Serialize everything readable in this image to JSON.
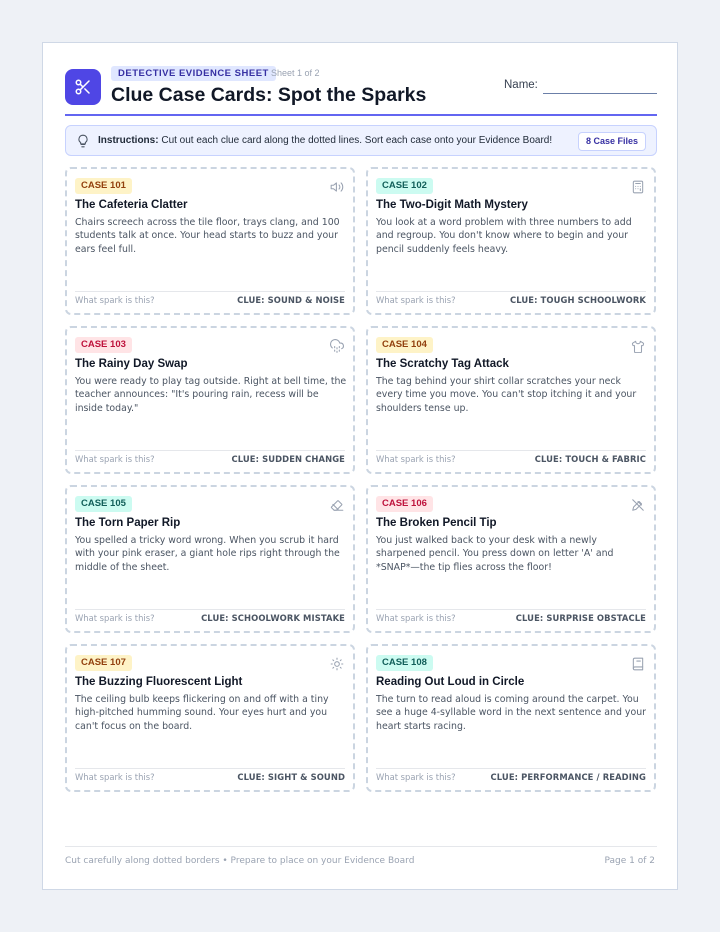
{
  "header": {
    "badge": "DETECTIVE EVIDENCE SHEET",
    "sheet_label": "Sheet 1 of 2",
    "title": "Clue Case Cards: Spot the Sparks",
    "name_label": "Name:"
  },
  "instructions": {
    "label": "Instructions:",
    "text": " Cut out each clue card along the dotted lines. Sort each case onto your Evidence Board!",
    "count": "8 Case Files"
  },
  "cards": [
    {
      "case": "CASE 101",
      "color": "yellow",
      "icon": "speaker-icon",
      "title": "The Cafeteria Clatter",
      "body": "Chairs screech across the tile floor, trays clang, and 100 students talk at once. Your head starts to buzz and your ears feel full.",
      "question": "What spark is this?",
      "clue": "CLUE: SOUND & NOISE"
    },
    {
      "case": "CASE 102",
      "color": "teal",
      "icon": "calculator-icon",
      "title": "The Two-Digit Math Mystery",
      "body": "You look at a word problem with three numbers to add and regroup. You don't know where to begin and your pencil suddenly feels heavy.",
      "question": "What spark is this?",
      "clue": "CLUE: TOUGH SCHOOLWORK"
    },
    {
      "case": "CASE 103",
      "color": "red",
      "icon": "rain-cloud-icon",
      "title": "The Rainy Day Swap",
      "body": "You were ready to play tag outside. Right at bell time, the teacher announces: \"It's pouring rain, recess will be inside today.\"",
      "question": "What spark is this?",
      "clue": "CLUE: SUDDEN CHANGE"
    },
    {
      "case": "CASE 104",
      "color": "yellow",
      "icon": "shirt-icon",
      "title": "The Scratchy Tag Attack",
      "body": "The tag behind your shirt collar scratches your neck every time you move. You can't stop itching it and your shoulders tense up.",
      "question": "What spark is this?",
      "clue": "CLUE: TOUCH & FABRIC"
    },
    {
      "case": "CASE 105",
      "color": "teal",
      "icon": "eraser-icon",
      "title": "The Torn Paper Rip",
      "body": "You spelled a tricky word wrong. When you scrub it hard with your pink eraser, a giant hole rips right through the middle of the sheet.",
      "question": "What spark is this?",
      "clue": "CLUE: SCHOOLWORK MISTAKE"
    },
    {
      "case": "CASE 106",
      "color": "red",
      "icon": "broken-pencil-icon",
      "title": "The Broken Pencil Tip",
      "body": "You just walked back to your desk with a newly sharpened pencil. You press down on letter 'A' and *SNAP*—the tip flies across the floor!",
      "question": "What spark is this?",
      "clue": "CLUE: SURPRISE OBSTACLE"
    },
    {
      "case": "CASE 107",
      "color": "yellow",
      "icon": "sun-icon",
      "title": "The Buzzing Fluorescent Light",
      "body": "The ceiling bulb keeps flickering on and off with a tiny high-pitched humming sound. Your eyes hurt and you can't focus on the board.",
      "question": "What spark is this?",
      "clue": "CLUE: SIGHT & SOUND"
    },
    {
      "case": "CASE 108",
      "color": "teal",
      "icon": "book-icon",
      "title": "Reading Out Loud in Circle",
      "body": "The turn to read aloud is coming around the carpet. You see a huge 4-syllable word in the next sentence and your heart starts racing.",
      "question": "What spark is this?",
      "clue": "CLUE: PERFORMANCE / READING"
    }
  ],
  "footer": {
    "left": "Cut carefully along dotted borders • Prepare to place on your Evidence Board",
    "right": "Page 1 of 2"
  }
}
